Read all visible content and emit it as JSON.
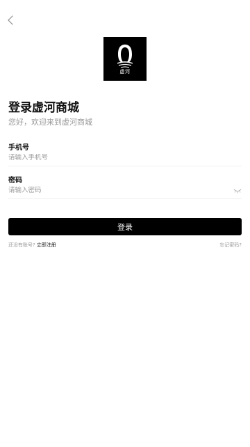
{
  "header": {
    "back_icon": "chevron-left-icon"
  },
  "logo": {
    "text": "虚河"
  },
  "page": {
    "title": "登录虚河商城",
    "subtitle": "您好，欢迎来到虚河商城"
  },
  "form": {
    "phone": {
      "label": "手机号",
      "placeholder": "请输入手机号",
      "value": ""
    },
    "password": {
      "label": "密码",
      "placeholder": "请输入密码",
      "value": "",
      "toggle_icon": "eye-closed-icon"
    },
    "submit_label": "登录"
  },
  "footer": {
    "register_prompt": "还没有账号?",
    "register_link": "立即注册",
    "forgot_link": "忘记密码?"
  },
  "colors": {
    "primary": "#000000",
    "muted_text": "#9a9a9a",
    "divider": "#f0f0f0"
  }
}
